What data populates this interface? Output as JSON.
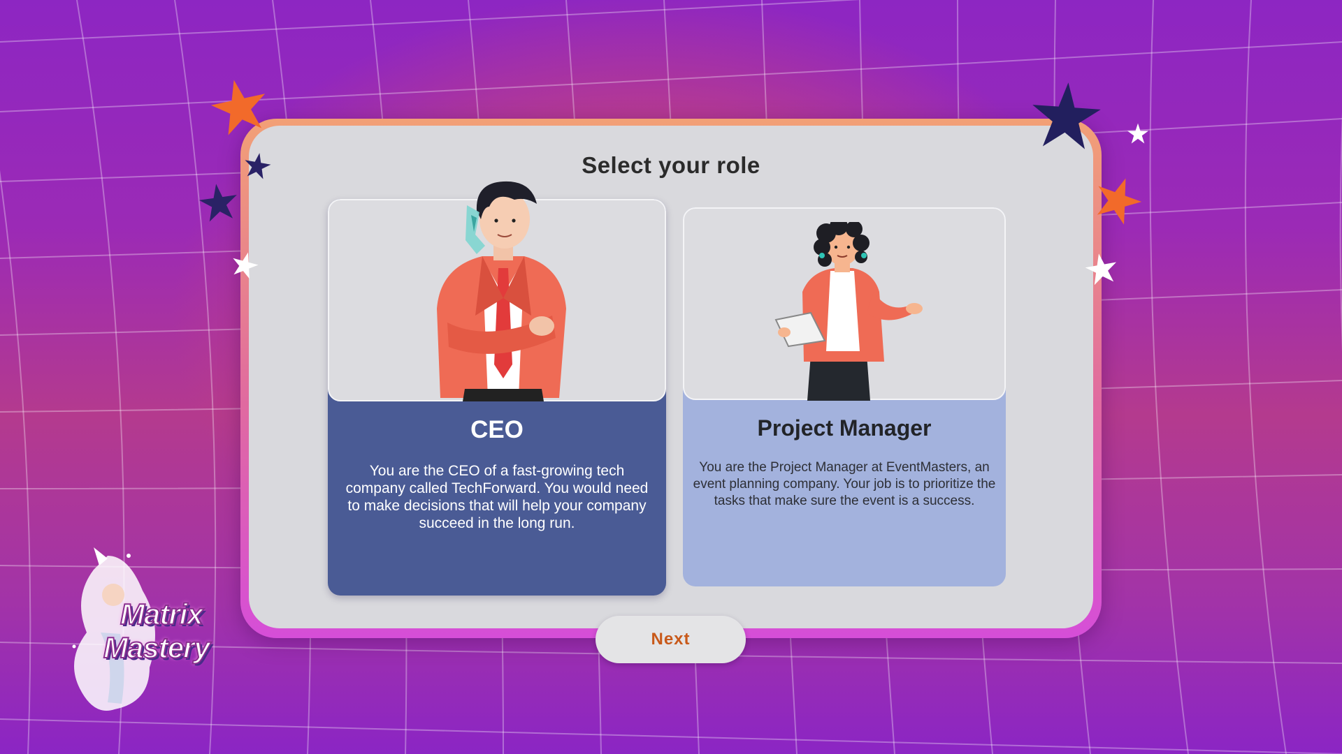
{
  "screen": {
    "title": "Select your role"
  },
  "roles": [
    {
      "name": "CEO",
      "description": "You are the CEO of a fast-growing tech company called TechForward. You would need to make decisions that will help your company succeed in the long run."
    },
    {
      "name": "Project Manager",
      "description": "You are the Project Manager at EventMasters, an event planning company. Your job is to prioritize the tasks that make sure the event is a success."
    }
  ],
  "actions": {
    "next_label": "Next"
  },
  "logo": {
    "line1": "Matrix",
    "line2": "Mastery"
  },
  "colors": {
    "card_selected": "#4a5b95",
    "card_unselected": "#a3b2dd",
    "next_text": "#c8591a",
    "accent_orange": "#f26a2a",
    "accent_navy": "#2a2266"
  },
  "icons": [
    "star-icon",
    "ceo-character-illustration",
    "project-manager-character-illustration",
    "game-logo"
  ]
}
